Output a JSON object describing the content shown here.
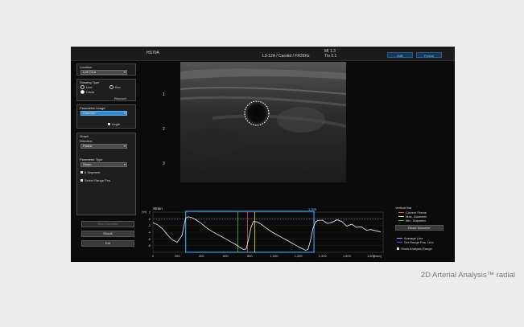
{
  "topbar": {
    "system_label": "HS70A",
    "probe_info": "L3-12A / Carotid / FR26Hz",
    "mi": "MI 1.3",
    "tis": "TIs 0.1",
    "edit_button": "Edit",
    "freeze_button": "Freeze"
  },
  "panel": {
    "location": {
      "header": "Location",
      "value": "Left CCA"
    },
    "drawing_type": {
      "header": "Drawing Type",
      "options": [
        "Line",
        "Box",
        "Circle"
      ],
      "selected": "Circle",
      "recover_label": "Recover"
    },
    "parametric_image": {
      "header": "Parametric Image",
      "value": "Diameter",
      "angle_label": "Angle"
    },
    "graph": {
      "header": "Graph",
      "direction_label": "Direction",
      "direction_value": "Radial",
      "param_type_label": "Parameter Type",
      "param_type_value": "Strain",
      "segment_label": "6 Segment",
      "select_range_label": "Select Range Pos."
    },
    "buttons": {
      "run_compare": "Run Compare",
      "result": "Result",
      "exit": "Exit"
    }
  },
  "depth_ticks": [
    "1",
    "2",
    "3"
  ],
  "chart_data": {
    "type": "line",
    "title": "Strain",
    "ylabel": "(%)",
    "xlabel": "[msec]",
    "xlim": [
      0,
      1900
    ],
    "ylim": [
      -10,
      2
    ],
    "x_ticks": [
      "0",
      "200",
      "400",
      "600",
      "800",
      "1,000",
      "1,200",
      "1,400",
      "1,600",
      "1,800"
    ],
    "y_ticks": [
      "2",
      "0",
      "-2",
      "-4",
      "-6",
      "-8"
    ],
    "range_label": "1,329",
    "range_start": 270,
    "range_end": 1329,
    "current_frame": 780,
    "max_diameter": 840,
    "min_diameter": 700,
    "x": [
      0,
      40,
      80,
      120,
      160,
      200,
      240,
      270,
      290,
      320,
      360,
      400,
      440,
      480,
      520,
      560,
      600,
      640,
      680,
      720,
      750,
      770,
      790,
      810,
      830,
      860,
      900,
      940,
      980,
      1020,
      1060,
      1100,
      1140,
      1180,
      1220,
      1260,
      1280,
      1300,
      1320,
      1340,
      1360,
      1400,
      1440,
      1480,
      1520,
      1560,
      1600,
      1640,
      1680,
      1720,
      1760,
      1800,
      1840,
      1880
    ],
    "y": [
      -1.2,
      -1.8,
      -3.0,
      -4.8,
      -6.3,
      -7.0,
      -5.0,
      0.2,
      0.6,
      0.4,
      -0.4,
      -1.4,
      -2.6,
      -3.6,
      -4.4,
      -5.2,
      -6.0,
      -6.8,
      -7.6,
      -8.6,
      -9.2,
      -9.0,
      -6.0,
      -2.5,
      -0.8,
      -0.9,
      -1.8,
      -2.9,
      -3.9,
      -4.7,
      -5.5,
      -6.3,
      -7.1,
      -7.9,
      -8.7,
      -9.4,
      -9.1,
      -6.5,
      -3.0,
      -1.0,
      -0.5,
      -0.4,
      -1.4,
      -1.0,
      -0.3,
      -0.8,
      -2.2,
      -1.6,
      -2.5,
      -2.4,
      -3.4,
      -3.2,
      -3.6,
      -3.9
    ]
  },
  "graph_legend": {
    "title": "Vertical Bar",
    "items": [
      "Current Frame",
      "Max. Diameter",
      "Min. Diameter"
    ],
    "item_colors": [
      "#e24b4b",
      "#e5e533",
      "#38d038"
    ],
    "reset_label": "Reset Diameter",
    "line_items": [
      "Average Line",
      "Set Range Pos. Line"
    ],
    "line_colors": [
      "#9aa0ff",
      "#7a3fe0"
    ],
    "show_range_label": "Show Analysis Range"
  },
  "caption": "2D Arterial Analysis™ radial"
}
